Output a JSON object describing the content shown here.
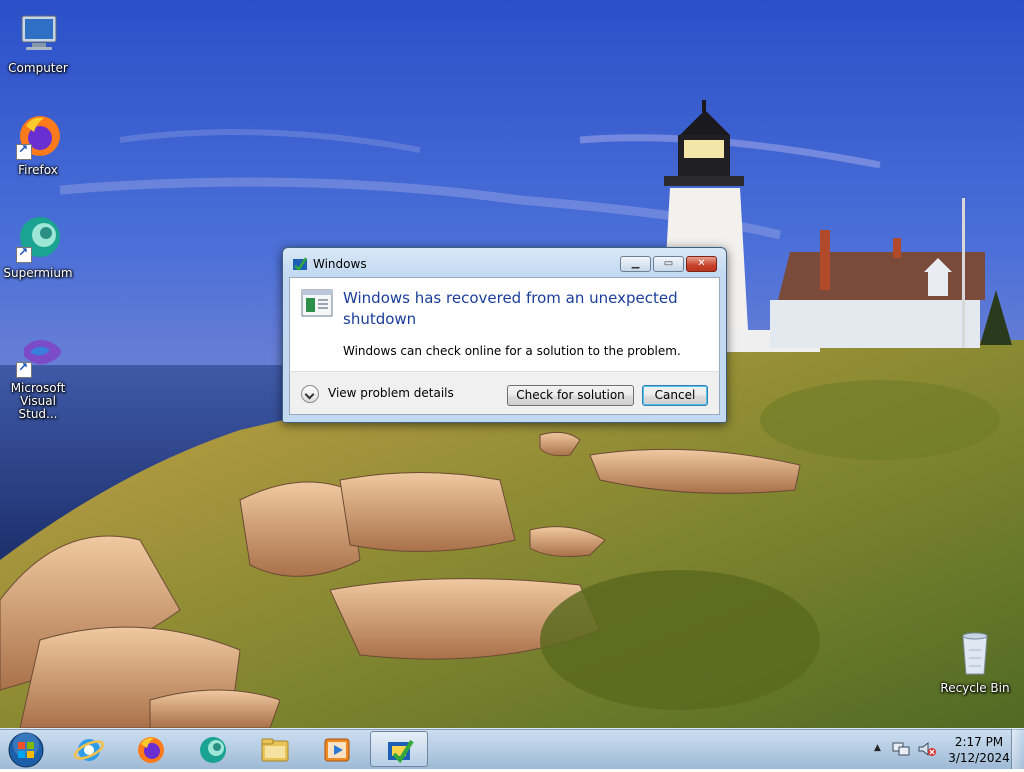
{
  "desktop": {
    "icons": [
      {
        "label": "Computer"
      },
      {
        "label": "Firefox"
      },
      {
        "label": "Supermium"
      },
      {
        "label": "Microsoft Visual Stud..."
      },
      {
        "label": "Recycle Bin"
      }
    ]
  },
  "dialog": {
    "title": "Windows",
    "heading": "Windows has recovered from an unexpected shutdown",
    "description": "Windows can check online for a solution to the problem.",
    "details_label": "View problem details",
    "check_button": "Check for solution",
    "cancel_button": "Cancel",
    "caption_buttons": {
      "minimize": "▁",
      "maximize": "▭",
      "close": "✕"
    }
  },
  "taskbar": {
    "pinned": [
      {
        "name": "internet-explorer-icon"
      },
      {
        "name": "firefox-icon"
      },
      {
        "name": "supermium-icon"
      },
      {
        "name": "file-explorer-icon"
      },
      {
        "name": "media-player-icon"
      },
      {
        "name": "problem-reports-icon",
        "active": true
      }
    ],
    "tray": {
      "show_hidden": "▲",
      "network_icon": "network-icon",
      "volume_icon": "volume-muted-icon"
    },
    "clock": {
      "time": "2:17 PM",
      "date": "3/12/2024"
    }
  },
  "colors": {
    "dialog_heading": "#1b3e9a",
    "taskbar": "#b4cce4",
    "close_button": "#c7402a"
  }
}
